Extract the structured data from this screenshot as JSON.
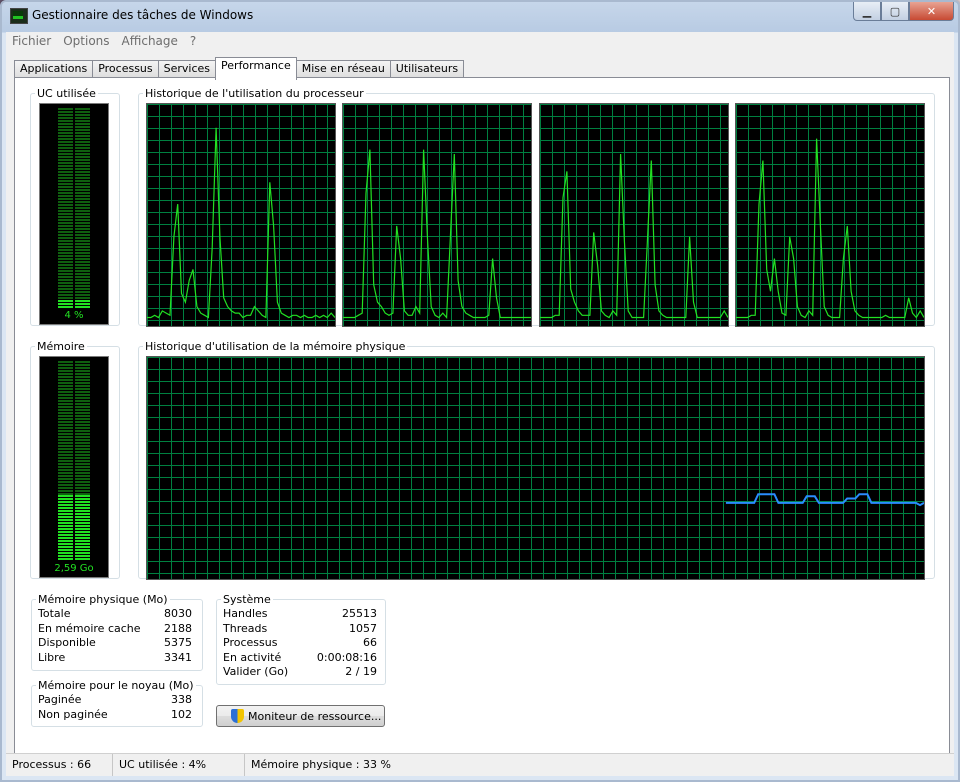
{
  "window": {
    "title": "Gestionnaire des tâches de Windows"
  },
  "menu": [
    "Fichier",
    "Options",
    "Affichage",
    "?"
  ],
  "tabs": [
    "Applications",
    "Processus",
    "Services",
    "Performance",
    "Mise en réseau",
    "Utilisateurs"
  ],
  "active_tab": "Performance",
  "cpu": {
    "usage_title": "UC utilisée",
    "usage_label": "4 %",
    "usage_fraction": 0.04,
    "history_title": "Historique de l'utilisation du processeur",
    "history_cores": [
      [
        3,
        3,
        4,
        3,
        6,
        5,
        4,
        40,
        55,
        14,
        10,
        20,
        25,
        8,
        5,
        4,
        3,
        35,
        90,
        40,
        12,
        8,
        6,
        5,
        5,
        3,
        4,
        4,
        8,
        6,
        4,
        3,
        65,
        45,
        10,
        5,
        4,
        3,
        4,
        4,
        3,
        4,
        3,
        3,
        4,
        3,
        4,
        3,
        5,
        3
      ],
      [
        3,
        3,
        3,
        3,
        4,
        5,
        60,
        80,
        18,
        10,
        8,
        5,
        4,
        5,
        45,
        30,
        6,
        4,
        4,
        8,
        5,
        80,
        40,
        8,
        4,
        3,
        5,
        3,
        40,
        78,
        20,
        8,
        5,
        4,
        3,
        3,
        3,
        3,
        4,
        30,
        12,
        3,
        3,
        3,
        3,
        3,
        3,
        3,
        3,
        3
      ],
      [
        3,
        3,
        3,
        3,
        4,
        4,
        58,
        70,
        16,
        10,
        6,
        4,
        4,
        4,
        42,
        27,
        6,
        4,
        3,
        6,
        4,
        78,
        38,
        6,
        3,
        3,
        3,
        3,
        38,
        75,
        18,
        6,
        4,
        3,
        3,
        3,
        3,
        3,
        3,
        40,
        10,
        3,
        3,
        3,
        3,
        3,
        3,
        3,
        6,
        3
      ],
      [
        3,
        3,
        3,
        3,
        4,
        4,
        55,
        75,
        25,
        15,
        30,
        15,
        5,
        4,
        40,
        30,
        8,
        4,
        3,
        6,
        4,
        85,
        45,
        8,
        4,
        3,
        3,
        3,
        30,
        45,
        15,
        6,
        4,
        3,
        3,
        3,
        3,
        3,
        3,
        4,
        3,
        3,
        3,
        3,
        3,
        12,
        5,
        3,
        6,
        3
      ]
    ]
  },
  "memory": {
    "usage_title": "Mémoire",
    "usage_label": "2,59 Go",
    "usage_fraction": 0.33,
    "history_title": "Historique d'utilisation de la mémoire physique",
    "history": [
      34,
      34,
      34,
      34,
      34,
      34,
      34,
      34,
      38,
      38,
      38,
      38,
      38,
      34,
      34,
      34,
      34,
      34,
      34,
      34,
      37,
      37,
      37,
      34,
      34,
      34,
      34,
      34,
      34,
      34,
      36,
      36,
      36,
      38,
      38,
      38,
      34,
      34,
      34,
      34,
      34,
      34,
      34,
      34,
      34,
      34,
      34,
      34,
      33,
      34
    ]
  },
  "physical_memory": {
    "title": "Mémoire physique (Mo)",
    "rows": [
      {
        "label": "Totale",
        "value": "8030"
      },
      {
        "label": "En mémoire cache",
        "value": "2188"
      },
      {
        "label": "Disponible",
        "value": "5375"
      },
      {
        "label": "Libre",
        "value": "3341"
      }
    ]
  },
  "kernel_memory": {
    "title": "Mémoire pour le noyau (Mo)",
    "rows": [
      {
        "label": "Paginée",
        "value": "338"
      },
      {
        "label": "Non paginée",
        "value": "102"
      }
    ]
  },
  "system": {
    "title": "Système",
    "rows": [
      {
        "label": "Handles",
        "value": "25513"
      },
      {
        "label": "Threads",
        "value": "1057"
      },
      {
        "label": "Processus",
        "value": "66"
      },
      {
        "label": "En activité",
        "value": "0:00:08:16"
      },
      {
        "label": "Valider (Go)",
        "value": "2 / 19"
      }
    ]
  },
  "resource_monitor_button": "Moniteur de ressource...",
  "status": {
    "processes": "Processus : 66",
    "cpu": "UC utilisée : 4%",
    "memory": "Mémoire physique : 33 %"
  },
  "colors": {
    "graph_grid": "#008040",
    "cpu_line": "#22e022",
    "mem_line": "#2a8cff"
  }
}
